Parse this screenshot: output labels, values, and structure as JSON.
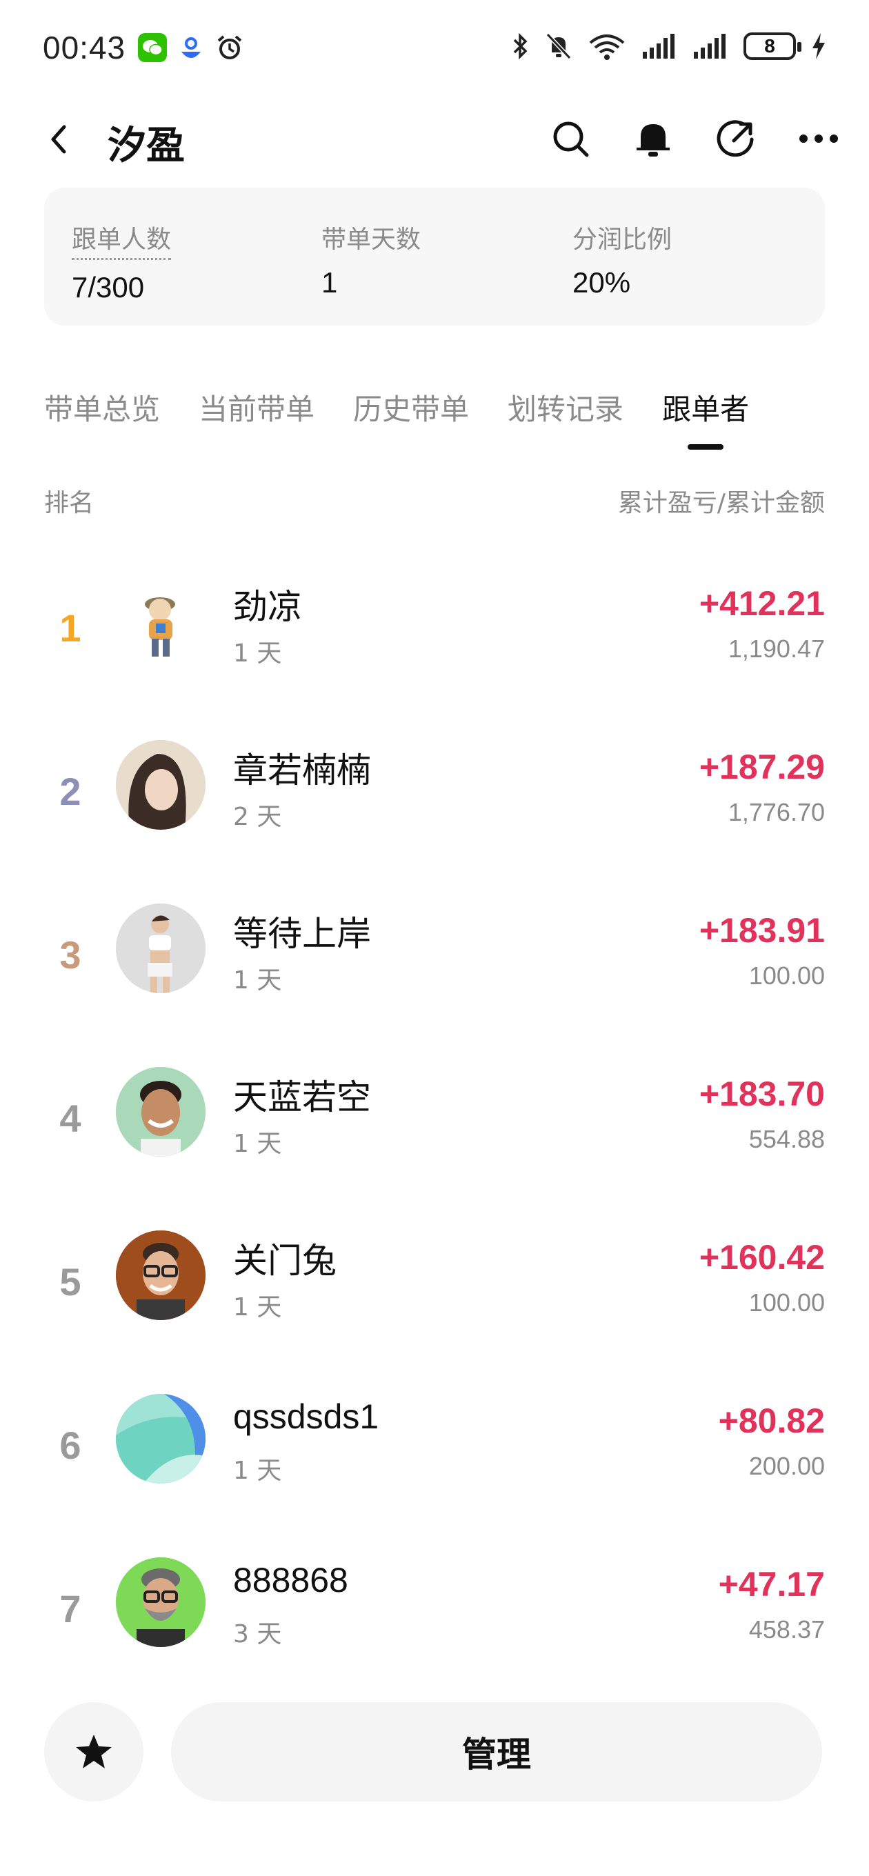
{
  "status_bar": {
    "time": "00:43",
    "battery": "8",
    "icons": [
      "wechat-icon",
      "baidu-icon",
      "alarm-icon",
      "bluetooth-icon",
      "mute-icon",
      "wifi-icon",
      "signal-icon",
      "signal-icon",
      "battery-icon",
      "charging-icon"
    ]
  },
  "header": {
    "title": "汐盈",
    "back_icon": "back-chevron-icon",
    "actions": [
      "search-icon",
      "bell-icon",
      "share-icon",
      "more-icon"
    ]
  },
  "stats": [
    {
      "label": "跟单人数",
      "value": "7/300"
    },
    {
      "label": "带单天数",
      "value": "1"
    },
    {
      "label": "分润比例",
      "value": "20%"
    }
  ],
  "tabs": [
    {
      "label": "带单总览",
      "active": false
    },
    {
      "label": "当前带单",
      "active": false
    },
    {
      "label": "历史带单",
      "active": false
    },
    {
      "label": "划转记录",
      "active": false
    },
    {
      "label": "跟单者",
      "active": true
    }
  ],
  "list_header": {
    "left": "排名",
    "right": "累计盈亏/累计金额"
  },
  "colors": {
    "profit": "#e0325a",
    "rank_1": "#f5a623",
    "rank_2": "#8e8fb5",
    "rank_3": "#c99a7a",
    "rank_other": "#9a9a9a"
  },
  "followers": [
    {
      "rank": "1",
      "name": "劲凉",
      "days": "1 天",
      "pnl": "+412.21",
      "amount": "1,190.47",
      "avatar": "cartoon-boy-avatar"
    },
    {
      "rank": "2",
      "name": "章若楠楠",
      "days": "2 天",
      "pnl": "+187.29",
      "amount": "1,776.70",
      "avatar": "woman-photo-avatar"
    },
    {
      "rank": "3",
      "name": "等待上岸",
      "days": "1 天",
      "pnl": "+183.91",
      "amount": "100.00",
      "avatar": "woman-fitness-avatar"
    },
    {
      "rank": "4",
      "name": "天蓝若空",
      "days": "1 天",
      "pnl": "+183.70",
      "amount": "554.88",
      "avatar": "smiling-man-avatar"
    },
    {
      "rank": "5",
      "name": "关门兔",
      "days": "1 天",
      "pnl": "+160.42",
      "amount": "100.00",
      "avatar": "man-glasses-avatar"
    },
    {
      "rank": "6",
      "name": "qssdsds1",
      "days": "1 天",
      "pnl": "+80.82",
      "amount": "200.00",
      "avatar": "abstract-teal-avatar"
    },
    {
      "rank": "7",
      "name": "888868",
      "days": "3 天",
      "pnl": "+47.17",
      "amount": "458.37",
      "avatar": "bearded-man-avatar"
    }
  ],
  "bottom": {
    "favorite_icon": "star-icon",
    "manage_label": "管理"
  }
}
